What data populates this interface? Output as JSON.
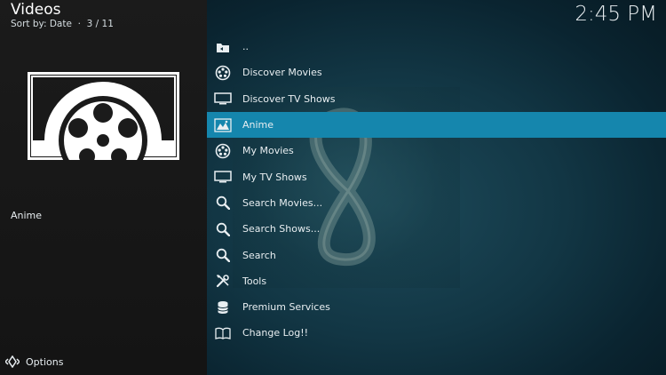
{
  "header": {
    "title": "Videos",
    "subtitle": "Sort by: Date  ·  3 / 11",
    "clock": "2:45 PM"
  },
  "selected": {
    "label": "Anime"
  },
  "footer": {
    "options_label": "Options"
  },
  "list": {
    "focused_index": 3,
    "items": [
      {
        "label": "..",
        "icon": "folder-back-icon"
      },
      {
        "label": "Discover Movies",
        "icon": "film-reel-icon"
      },
      {
        "label": "Discover TV Shows",
        "icon": "tv-icon"
      },
      {
        "label": "Anime",
        "icon": "anime-icon"
      },
      {
        "label": "My Movies",
        "icon": "film-reel-icon"
      },
      {
        "label": "My TV Shows",
        "icon": "tv-icon"
      },
      {
        "label": "Search Movies...",
        "icon": "search-icon"
      },
      {
        "label": "Search Shows...",
        "icon": "search-icon"
      },
      {
        "label": "Search",
        "icon": "search-icon"
      },
      {
        "label": "Tools",
        "icon": "tools-icon"
      },
      {
        "label": "Premium Services",
        "icon": "database-icon"
      },
      {
        "label": "Change Log!!",
        "icon": "book-icon"
      }
    ]
  },
  "colors": {
    "focus": "#1586ad",
    "left_panel": "#1b1b1b",
    "right_bg": "#123644"
  }
}
